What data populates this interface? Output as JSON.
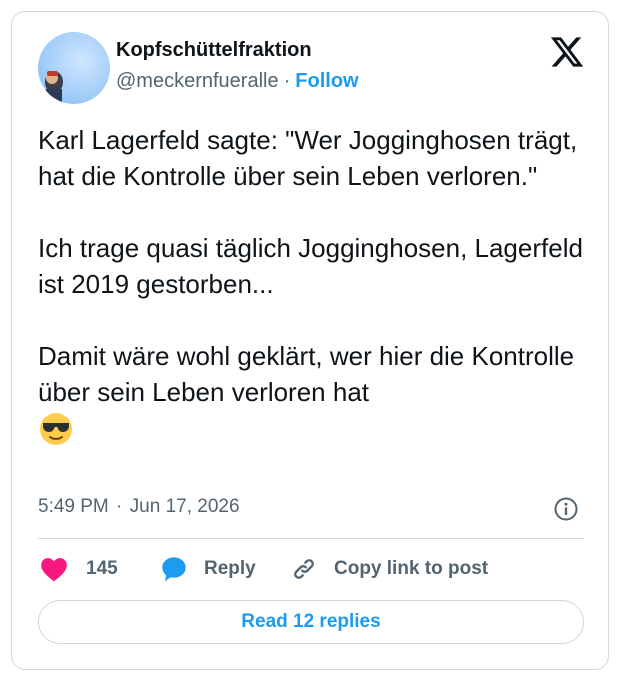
{
  "author": {
    "display_name": "Kopfschüttelfraktion",
    "handle": "@meckernfueralle",
    "separator": "·",
    "follow_label": "Follow"
  },
  "tweet": {
    "paragraphs": [
      "Karl Lagerfeld sagte: \"Wer Jogginghosen trägt, hat die Kontrolle über sein Leben verloren.\"",
      "Ich trage quasi täglich Jogginghosen, Lagerfeld ist 2019 gestorben...",
      "Damit wäre wohl geklärt, wer hier die Kontrolle über sein Leben verloren hat"
    ],
    "emoji_name": "smiling-face-with-sunglasses",
    "time": "5:49 PM",
    "time_separator": "·",
    "date": "Jun 17, 2026"
  },
  "actions": {
    "like_count": "145",
    "reply_label": "Reply",
    "copy_link_label": "Copy link to post"
  },
  "footer": {
    "read_replies_label": "Read 12 replies"
  },
  "icons": {
    "platform_logo": "x-logo-icon",
    "info": "info-icon",
    "like": "heart-icon",
    "reply": "speech-bubble-icon",
    "copy": "link-icon"
  },
  "colors": {
    "accent": "#1d9bf0",
    "like": "#f91880",
    "text": "#0f1419",
    "secondary": "#536471",
    "border": "#cfd9de"
  }
}
